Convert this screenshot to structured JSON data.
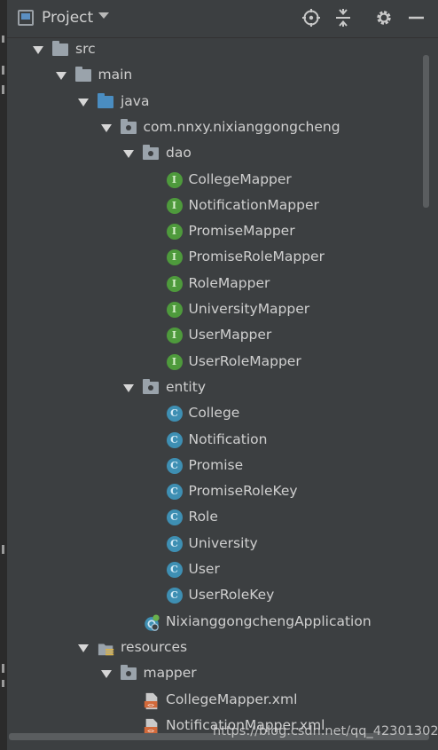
{
  "header": {
    "title": "Project",
    "icons": [
      "locate-icon",
      "collapse-all-icon",
      "gear-icon",
      "minimize-icon"
    ]
  },
  "tree": [
    {
      "label": "src",
      "icon": "folder-icon",
      "level": 0,
      "expanded": true
    },
    {
      "label": "main",
      "icon": "folder-icon",
      "level": 1,
      "expanded": true
    },
    {
      "label": "java",
      "icon": "source-folder-icon",
      "level": 2,
      "expanded": true
    },
    {
      "label": "com.nnxy.nixianggongcheng",
      "icon": "package-icon",
      "level": 3,
      "expanded": true
    },
    {
      "label": "dao",
      "icon": "package-icon",
      "level": 4,
      "expanded": true
    },
    {
      "label": "CollegeMapper",
      "icon": "interface-icon",
      "level": 5
    },
    {
      "label": "NotificationMapper",
      "icon": "interface-icon",
      "level": 5
    },
    {
      "label": "PromiseMapper",
      "icon": "interface-icon",
      "level": 5
    },
    {
      "label": "PromiseRoleMapper",
      "icon": "interface-icon",
      "level": 5
    },
    {
      "label": "RoleMapper",
      "icon": "interface-icon",
      "level": 5
    },
    {
      "label": "UniversityMapper",
      "icon": "interface-icon",
      "level": 5
    },
    {
      "label": "UserMapper",
      "icon": "interface-icon",
      "level": 5
    },
    {
      "label": "UserRoleMapper",
      "icon": "interface-icon",
      "level": 5
    },
    {
      "label": "entity",
      "icon": "package-icon",
      "level": 4,
      "expanded": true
    },
    {
      "label": "College",
      "icon": "class-icon",
      "level": 5
    },
    {
      "label": "Notification",
      "icon": "class-icon",
      "level": 5
    },
    {
      "label": "Promise",
      "icon": "class-icon",
      "level": 5
    },
    {
      "label": "PromiseRoleKey",
      "icon": "class-icon",
      "level": 5
    },
    {
      "label": "Role",
      "icon": "class-icon",
      "level": 5
    },
    {
      "label": "University",
      "icon": "class-icon",
      "level": 5
    },
    {
      "label": "User",
      "icon": "class-icon",
      "level": 5
    },
    {
      "label": "UserRoleKey",
      "icon": "class-icon",
      "level": 5
    },
    {
      "label": "NixianggongchengApplication",
      "icon": "spring-app-icon",
      "level": 4
    },
    {
      "label": "resources",
      "icon": "resources-folder-icon",
      "level": 2,
      "expanded": true
    },
    {
      "label": "mapper",
      "icon": "package-icon",
      "level": 3,
      "expanded": true
    },
    {
      "label": "CollegeMapper.xml",
      "icon": "xml-file-icon",
      "level": 4
    },
    {
      "label": "NotificationMapper.xml",
      "icon": "xml-file-icon",
      "level": 4
    }
  ],
  "badge_letters": {
    "interface": "I",
    "class": "C"
  },
  "colors": {
    "background": "#3c3f41",
    "interface_badge": "#4e9a3c",
    "class_badge": "#3e8fb3",
    "source_folder": "#4a8dc1",
    "xml_icon": "#d2693a"
  },
  "watermark": "https://blog.csdn.net/qq_42301302"
}
